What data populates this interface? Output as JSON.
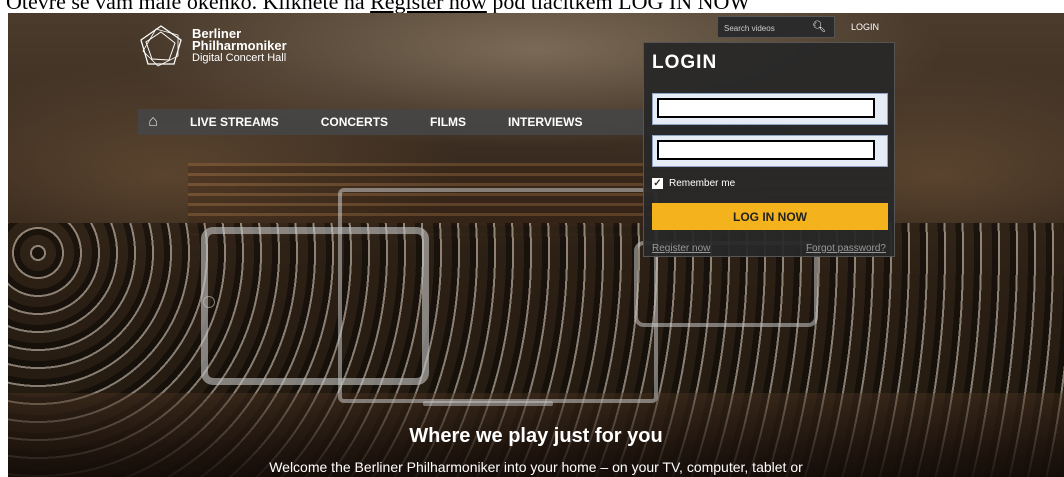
{
  "doc": {
    "text_before": "Otevře se vám malé okénko. Klikněte na ",
    "link_text": "Register now",
    "text_after": " pod tlačítkem LOG IN NOW"
  },
  "logo": {
    "line1": "Berliner",
    "line2": "Philharmoniker",
    "line3": "Digital Concert Hall"
  },
  "nav": {
    "items": [
      "LIVE STREAMS",
      "CONCERTS",
      "FILMS",
      "INTERVIEWS"
    ]
  },
  "search": {
    "placeholder": "Search videos"
  },
  "header": {
    "login_label": "LOGIN"
  },
  "login_panel": {
    "title": "LOGIN",
    "username_value": "",
    "password_value": "",
    "remember_label": "Remember me",
    "remember_checked": true,
    "submit_label": "LOG IN NOW",
    "register_label": "Register now",
    "forgot_label": "Forgot password?"
  },
  "hero": {
    "headline": "Where we play just for you",
    "subline": "Welcome the Berliner Philharmoniker into your home – on your TV, computer, tablet or"
  },
  "colors": {
    "accent": "#f4b21c",
    "panel_bg": "#282828",
    "nav_bg": "#464646"
  }
}
